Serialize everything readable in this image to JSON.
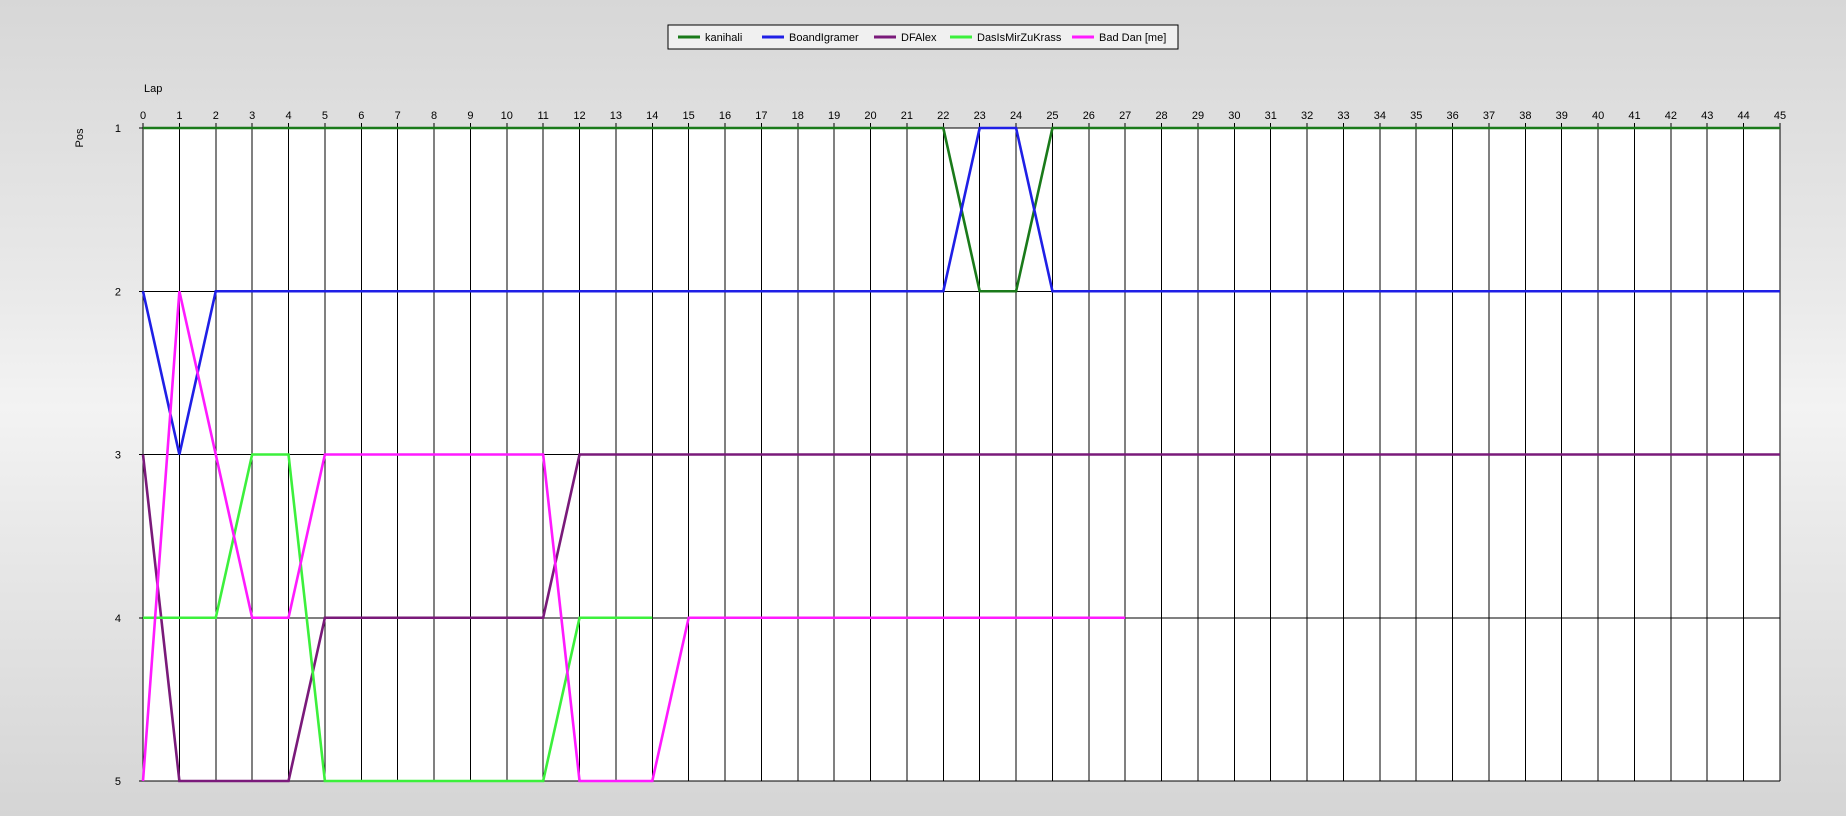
{
  "chart_data": {
    "type": "line",
    "xlabel": "Lap",
    "ylabel": "Pos",
    "xlim": [
      0,
      45
    ],
    "ylim": [
      1,
      5
    ],
    "y_inverted": true,
    "grid": true,
    "legend_position": "top-center",
    "x": [
      0,
      1,
      2,
      3,
      4,
      5,
      6,
      7,
      8,
      9,
      10,
      11,
      12,
      13,
      14,
      15,
      16,
      17,
      18,
      19,
      20,
      21,
      22,
      23,
      24,
      25,
      26,
      27,
      28,
      29,
      30,
      31,
      32,
      33,
      34,
      35,
      36,
      37,
      38,
      39,
      40,
      41,
      42,
      43,
      44,
      45
    ],
    "yticks": [
      1,
      2,
      3,
      4,
      5
    ],
    "series": [
      {
        "name": "kanihali",
        "color": "#1a7a1a",
        "values": [
          1,
          1,
          1,
          1,
          1,
          1,
          1,
          1,
          1,
          1,
          1,
          1,
          1,
          1,
          1,
          1,
          1,
          1,
          1,
          1,
          1,
          1,
          1,
          2,
          2,
          1,
          1,
          1,
          1,
          1,
          1,
          1,
          1,
          1,
          1,
          1,
          1,
          1,
          1,
          1,
          1,
          1,
          1,
          1,
          1,
          1
        ]
      },
      {
        "name": "BoandIgramer",
        "color": "#1f1fe6",
        "values": [
          2,
          3,
          2,
          2,
          2,
          2,
          2,
          2,
          2,
          2,
          2,
          2,
          2,
          2,
          2,
          2,
          2,
          2,
          2,
          2,
          2,
          2,
          2,
          1,
          1,
          2,
          2,
          2,
          2,
          2,
          2,
          2,
          2,
          2,
          2,
          2,
          2,
          2,
          2,
          2,
          2,
          2,
          2,
          2,
          2,
          2
        ]
      },
      {
        "name": "DFAlex",
        "color": "#7a1a7a",
        "values": [
          3,
          5,
          5,
          5,
          5,
          4,
          4,
          4,
          4,
          4,
          4,
          4,
          3,
          3,
          3,
          3,
          3,
          3,
          3,
          3,
          3,
          3,
          3,
          3,
          3,
          3,
          3,
          3,
          3,
          3,
          3,
          3,
          3,
          3,
          3,
          3,
          3,
          3,
          3,
          3,
          3,
          3,
          3,
          3,
          3,
          3
        ]
      },
      {
        "name": "DasIsMirZuKrass",
        "color": "#3cf03c",
        "values": [
          4,
          4,
          4,
          3,
          3,
          5,
          5,
          5,
          5,
          5,
          5,
          5,
          4,
          4,
          4
        ]
      },
      {
        "name": "Bad Dan [me]",
        "color": "#ff1aff",
        "values": [
          5,
          2,
          3,
          4,
          4,
          3,
          3,
          3,
          3,
          3,
          3,
          3,
          5,
          5,
          5,
          4,
          4,
          4,
          4,
          4,
          4,
          4,
          4,
          4,
          4,
          4,
          4,
          4
        ]
      }
    ]
  }
}
